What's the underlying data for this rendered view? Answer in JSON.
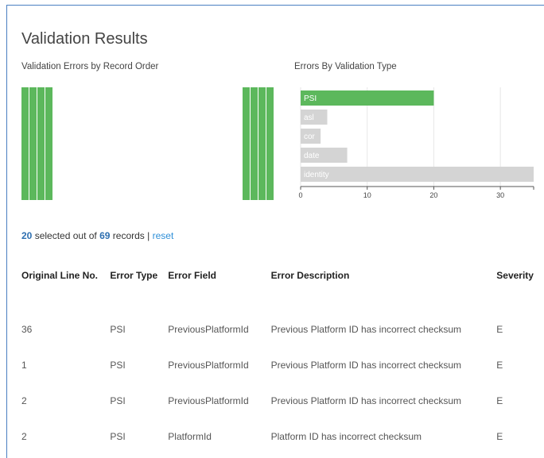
{
  "page_title": "Validation Results",
  "record_chart": {
    "title": "Validation Errors by Record Order",
    "color": "#5cb85c"
  },
  "chart_data": {
    "type": "bar",
    "orientation": "horizontal",
    "title": "Errors By Validation Type",
    "categories": [
      "PSI",
      "asl",
      "cor",
      "date",
      "identity"
    ],
    "values": [
      20,
      4,
      3,
      7,
      35
    ],
    "xlim": [
      0,
      35
    ],
    "xticks": [
      0,
      10,
      20,
      30
    ],
    "selected": "PSI",
    "colors": {
      "selected": "#5cb85c",
      "unselected": "#d4d4d4"
    },
    "grid": true
  },
  "summary": {
    "selected_count": "20",
    "selected_text": " selected out of ",
    "total_count": "69",
    "records_text": " records | ",
    "reset_label": "reset"
  },
  "table": {
    "columns": [
      "Original Line No.",
      "Error Type",
      "Error Field",
      "Error Description",
      "Severity"
    ],
    "rows": [
      [
        "36",
        "PSI",
        "PreviousPlatformId",
        "Previous Platform ID has incorrect checksum",
        "E"
      ],
      [
        "1",
        "PSI",
        "PreviousPlatformId",
        "Previous Platform ID has incorrect checksum",
        "E"
      ],
      [
        "2",
        "PSI",
        "PreviousPlatformId",
        "Previous Platform ID has incorrect checksum",
        "E"
      ],
      [
        "2",
        "PSI",
        "PlatformId",
        "Platform ID has incorrect checksum",
        "E"
      ]
    ]
  }
}
